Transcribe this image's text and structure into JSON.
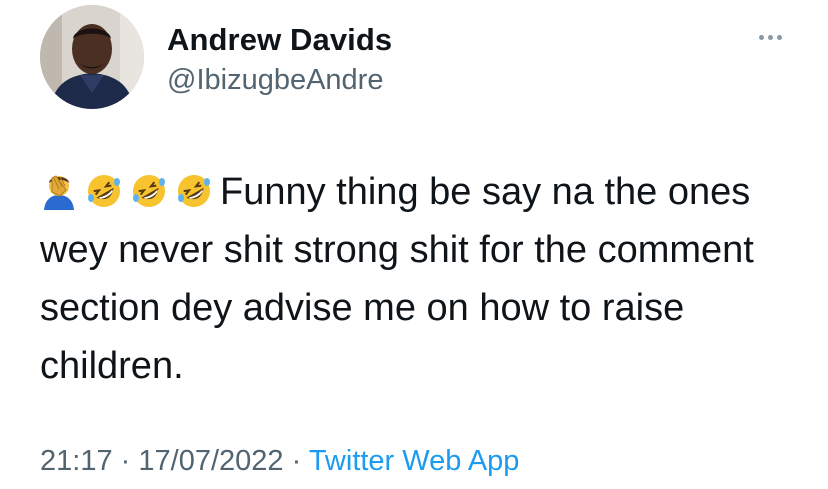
{
  "author": {
    "name": "Andrew Davids",
    "handle": "@IbizugbeAndre"
  },
  "tweet": {
    "emojis": [
      "face-palm-icon",
      "rolling-laughing-icon",
      "rolling-laughing-icon",
      "rolling-laughing-icon"
    ],
    "text": "Funny thing be say na the ones wey never shit strong shit for the comment section dey advise me on how to raise children."
  },
  "meta": {
    "time": "21:17",
    "separator": "·",
    "date": "17/07/2022",
    "source": "Twitter Web App"
  }
}
